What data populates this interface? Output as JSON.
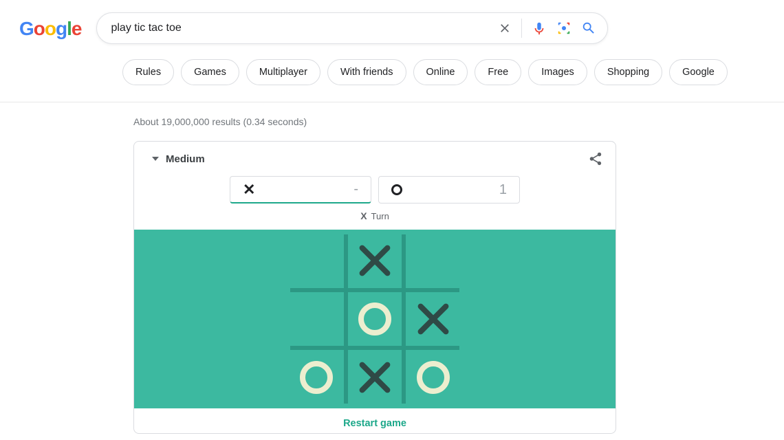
{
  "search": {
    "query": "play tic tac toe"
  },
  "chips": [
    "Rules",
    "Games",
    "Multiplayer",
    "With friends",
    "Online",
    "Free",
    "Images",
    "Shopping",
    "Google"
  ],
  "stats": "About 19,000,000 results (0.34 seconds)",
  "game": {
    "difficulty": "Medium",
    "score_x": "-",
    "score_o": "1",
    "turn_label": "Turn",
    "turn_symbol": "X",
    "board": [
      "",
      "X",
      "",
      "",
      "O",
      "X",
      "O",
      "X",
      "O"
    ],
    "restart_label": "Restart game"
  },
  "colors": {
    "board_bg": "#3cb9a0",
    "board_line": "#2c9884",
    "x_mark": "#2f4a46",
    "o_mark": "#eceecf",
    "accent": "#1da88a"
  }
}
